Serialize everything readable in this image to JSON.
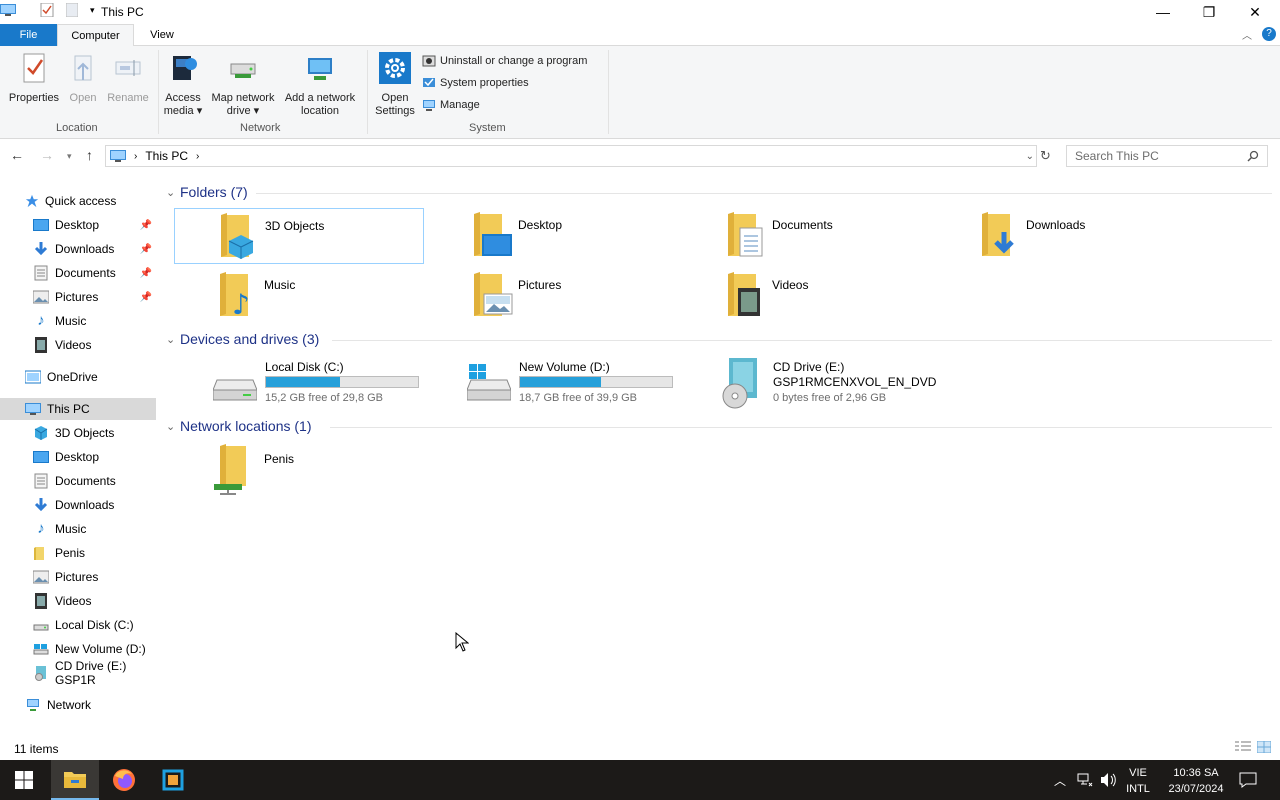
{
  "window": {
    "title": "This PC"
  },
  "ribbon_tabs": {
    "file": "File",
    "computer": "Computer",
    "view": "View"
  },
  "ribbon": {
    "location": {
      "label": "Location",
      "properties": "Properties",
      "open": "Open",
      "rename": "Rename"
    },
    "network": {
      "label": "Network",
      "access_media": "Access media",
      "map_network_drive": "Map network drive",
      "add_network_location": "Add a network location"
    },
    "system": {
      "label": "System",
      "open_settings": "Open Settings",
      "uninstall": "Uninstall or change a program",
      "system_properties": "System properties",
      "manage": "Manage"
    }
  },
  "address": {
    "path": "This PC",
    "search_placeholder": "Search This PC"
  },
  "sidebar": {
    "quick_access": "Quick access",
    "quick_items": [
      "Desktop",
      "Downloads",
      "Documents",
      "Pictures",
      "Music",
      "Videos"
    ],
    "onedrive": "OneDrive",
    "this_pc": "This PC",
    "pc_items": [
      "3D Objects",
      "Desktop",
      "Documents",
      "Downloads",
      "Music",
      "Penis",
      "Pictures",
      "Videos",
      "Local Disk (C:)",
      "New Volume (D:)",
      "CD Drive (E:) GSP1R"
    ],
    "network": "Network"
  },
  "sections": {
    "folders": "Folders (7)",
    "devices": "Devices and drives (3)",
    "network": "Network locations (1)"
  },
  "folders": [
    "3D Objects",
    "Desktop",
    "Documents",
    "Downloads",
    "Music",
    "Pictures",
    "Videos"
  ],
  "drives": [
    {
      "name": "Local Disk (C:)",
      "free": "15,2 GB free of 29,8 GB",
      "used_fraction": 0.49
    },
    {
      "name": "New Volume (D:)",
      "free": "18,7 GB free of 39,9 GB",
      "used_fraction": 0.53
    },
    {
      "name": "CD Drive (E:)",
      "label": "GSP1RMCENXVOL_EN_DVD",
      "free": "0 bytes free of 2,96 GB"
    }
  ],
  "network_locations": [
    "Penis"
  ],
  "status": {
    "items": "11 items"
  },
  "tray": {
    "day": "VIE",
    "lang": "INTL",
    "time": "10:36 SA",
    "date": "23/07/2024"
  },
  "colors": {
    "accent": "#1979ca",
    "bar": "#26a0da",
    "selection": "#99d1ff"
  }
}
